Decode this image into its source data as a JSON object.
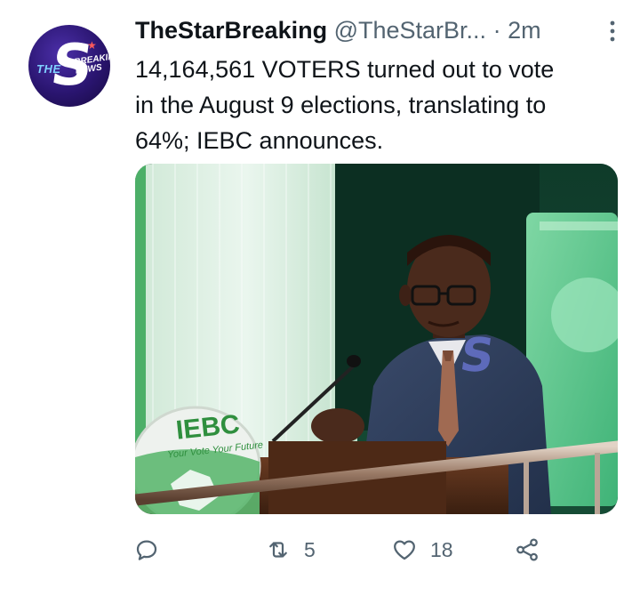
{
  "tweet": {
    "author_name": "TheStarBreaking",
    "handle": "@TheStarBr...",
    "separator": "·",
    "time": "2m",
    "text": "14,164,561 VOTERS turned out to vote\nin the August 9 elections, translating to\n64%; IEBC announces.",
    "avatar": {
      "logo_letter": "S",
      "logo_prefix": "THE",
      "logo_text": "BREAKING NEWS",
      "colors": {
        "bg": "#2a1570",
        "accent": "#7fd1ff",
        "star": "#ff5a5a"
      }
    },
    "media": {
      "podium_sign": "IEBC",
      "podium_tagline": "Your Vote Your Future",
      "watermark": "S"
    },
    "actions": {
      "reply": {
        "icon": "reply-icon",
        "count": ""
      },
      "retweet": {
        "icon": "retweet-icon",
        "count": "5"
      },
      "like": {
        "icon": "heart-icon",
        "count": "18"
      },
      "share": {
        "icon": "share-icon",
        "count": ""
      }
    },
    "colors": {
      "text": "#0f1419",
      "secondary": "#536471"
    }
  }
}
